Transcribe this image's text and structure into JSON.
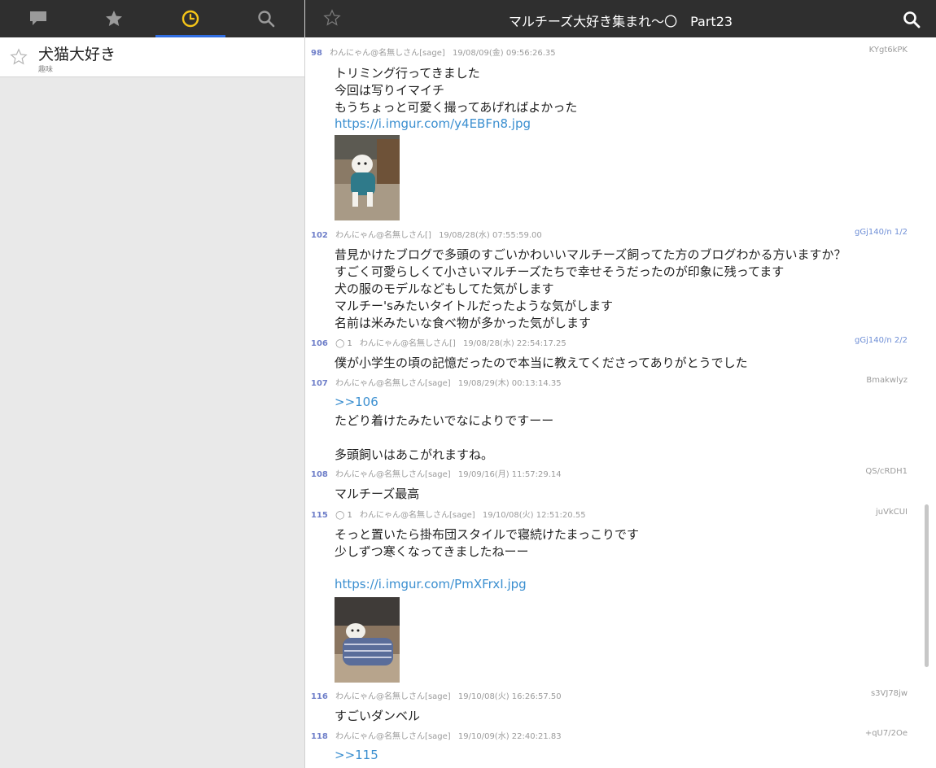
{
  "left": {
    "tabs": [
      {
        "name": "speech-bubble-icon",
        "active": false
      },
      {
        "name": "star-icon",
        "active": false
      },
      {
        "name": "clock-icon",
        "active": true
      },
      {
        "name": "search-icon",
        "active": false
      }
    ],
    "boards": [
      {
        "title": "犬猫大好き",
        "category": "趣味"
      }
    ]
  },
  "thread": {
    "title": "マルチーズ大好き集まれ〜〇　Part23"
  },
  "colors": {
    "toolbar": "#2f2f2f",
    "active_tab": "#f5c518",
    "active_underline": "#2f6de1",
    "link": "#3b8fd0",
    "post_number": "#6f7fc9"
  },
  "posts": [
    {
      "number": "98",
      "replies": "",
      "author": "わんにゃん@名無しさん[sage]",
      "date": "19/08/09(金) 09:56:26.35",
      "id": "KYgt6kPK",
      "lines": [
        "トリミング行ってきました",
        "今回は写りイマイチ",
        "もうちょっと可愛く撮ってあげればよかった",
        "https://i.imgur.com/y4EBFn8.jpg"
      ]
    },
    {
      "number": "102",
      "replies": "",
      "author": "わんにゃん@名無しさん[]",
      "date": "19/08/28(水) 07:55:59.00",
      "id": "gGj140/n 1/2",
      "lines": [
        "昔見かけたブログで多頭のすごいかわいいマルチーズ飼ってた方のブログわかる方いますか？",
        "すごく可愛らしくて小さいマルチーズたちで幸せそうだったのが印象に残ってます",
        "犬の服のモデルなどもしてた気がします",
        "マルチー'sみたいタイトルだったような気がします",
        "名前は米みたいな食べ物が多かった気がします"
      ]
    },
    {
      "number": "106",
      "replies": "1",
      "author": "わんにゃん@名無しさん[]",
      "date": "19/08/28(水) 22:54:17.25",
      "id": "gGj140/n 2/2",
      "lines": [
        "僕が小学生の頃の記憶だったので本当に教えてくださってありがとうでした"
      ]
    },
    {
      "number": "107",
      "replies": "",
      "author": "わんにゃん@名無しさん[sage]",
      "date": "19/08/29(木) 00:13:14.35",
      "id": "Bmakwlyz",
      "lines": [
        ">>106",
        "たどり着けたみたいでなによりですーー",
        "",
        "多頭飼いはあこがれますね。"
      ]
    },
    {
      "number": "108",
      "replies": "",
      "author": "わんにゃん@名無しさん[sage]",
      "date": "19/09/16(月) 11:57:29.14",
      "id": "QS/cRDH1",
      "lines": [
        "マルチーズ最高"
      ]
    },
    {
      "number": "115",
      "replies": "1",
      "author": "わんにゃん@名無しさん[sage]",
      "date": "19/10/08(火) 12:51:20.55",
      "id": "juVkCUI",
      "lines": [
        "そっと置いたら掛布団スタイルで寝続けたまっこりです",
        "少しずつ寒くなってきましたねーー",
        "",
        "https://i.imgur.com/PmXFrxI.jpg"
      ]
    },
    {
      "number": "116",
      "replies": "",
      "author": "わんにゃん@名無しさん[sage]",
      "date": "19/10/08(火) 16:26:57.50",
      "id": "s3VJ78jw",
      "lines": [
        "すごいダンベル"
      ]
    },
    {
      "number": "118",
      "replies": "",
      "author": "わんにゃん@名無しさん[sage]",
      "date": "19/10/09(水) 22:40:21.83",
      "id": "+qU7/2Oe",
      "lines": [
        ">>115"
      ]
    }
  ]
}
